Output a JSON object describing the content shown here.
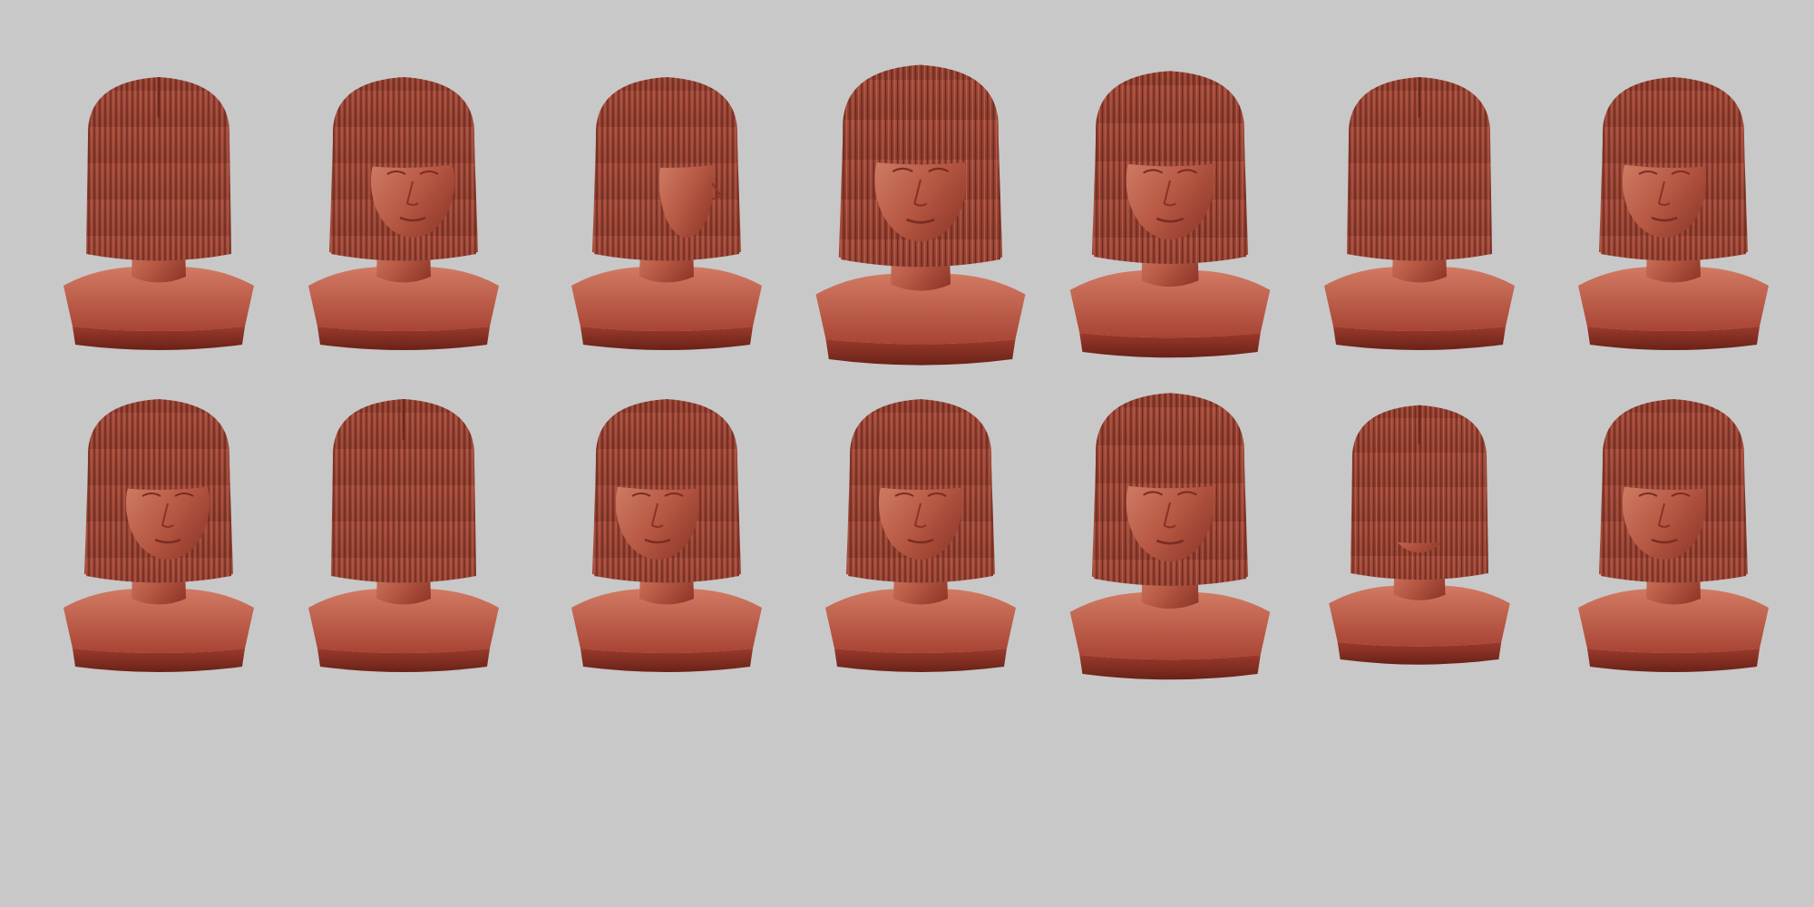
{
  "scene": {
    "background": "#c8c8c8",
    "material": "#b0503e",
    "material_light": "#d8806a",
    "material_shadow": "#7a2c22",
    "hair": "#9e4636",
    "hair_dark": "#6e2a20"
  },
  "rows": [
    {
      "views": [
        {
          "view": "back"
        },
        {
          "view": "three-quarter-right"
        },
        {
          "view": "profile-left"
        },
        {
          "view": "front-low"
        },
        {
          "view": "front"
        },
        {
          "view": "back-three-quarter"
        },
        {
          "view": "three-quarter-left"
        }
      ]
    },
    {
      "views": [
        {
          "view": "three-quarter-right"
        },
        {
          "view": "back-three-quarter"
        },
        {
          "view": "three-quarter-left"
        },
        {
          "view": "front-high"
        },
        {
          "view": "front"
        },
        {
          "view": "top-down"
        },
        {
          "view": "three-quarter-left"
        }
      ]
    }
  ]
}
